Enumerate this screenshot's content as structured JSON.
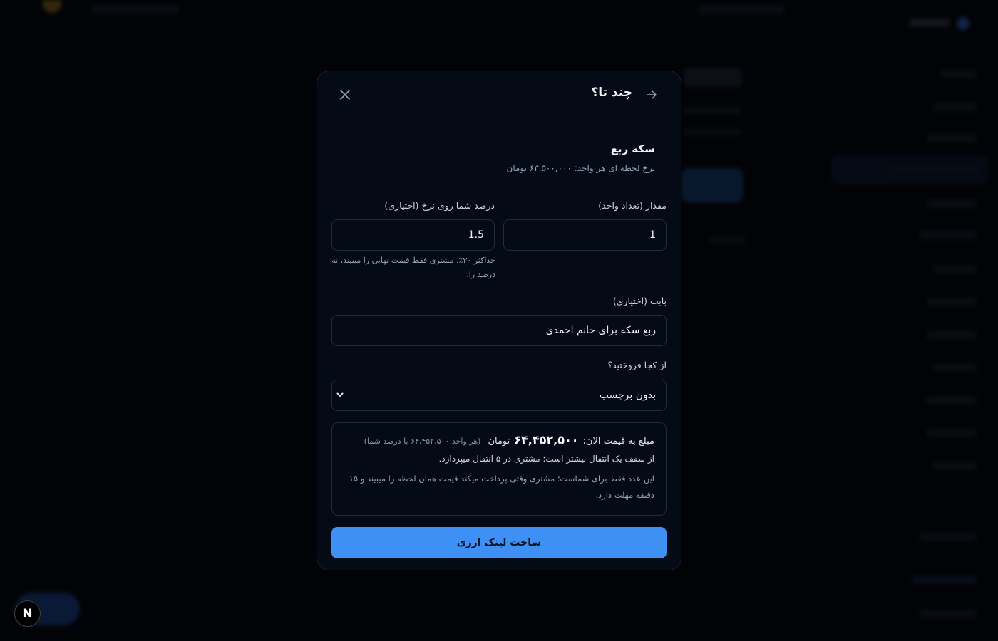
{
  "modal": {
    "title": "چند تا؟",
    "back_icon": "arrow-right-icon",
    "close_icon": "close-icon",
    "product": {
      "name": "سکه ربع",
      "rate_text": "نرخ لحظه ای هر واحد: ۶۳,۵۰۰,۰۰۰ تومان"
    },
    "quantity": {
      "label": "مقدار (تعداد واحد)",
      "value": "1"
    },
    "percent": {
      "label": "درصد شما روی نرخ (اختیاری)",
      "value": "1.5",
      "hint": "حداکثر ۳۰٪. مشتری فقط قیمت نهایی را میبیند، نه درصد را."
    },
    "reason": {
      "label": "بابت (اختیاری)",
      "value": "ربع سکه برای خانم احمدی"
    },
    "source": {
      "label": "از کجا فروختید؟",
      "selected": "بدون برچسب"
    },
    "summary": {
      "label": "مبلغ به قیمت الان:",
      "amount": "۶۴,۴۵۲,۵۰۰",
      "unit": "تومان",
      "note": "(هر واحد ۶۴,۴۵۲,۵۰۰ با درصد شما)",
      "transfer_note": "از سقف یک انتقال بیشتر است؛ مشتری در ۵ انتقال میپردازد.",
      "info": "این عدد فقط برای شماست؛ مشتری وقتی پرداخت میکند قیمت همان لحظه را میبیند و ۱۵ دقیقه مهلت دارد."
    },
    "submit_label": "ساخت لینک ارزی"
  },
  "dev_indicator": {
    "label": "N"
  }
}
